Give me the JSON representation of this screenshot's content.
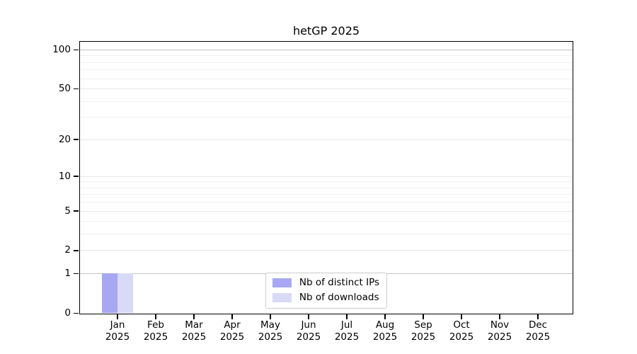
{
  "chart_data": {
    "type": "bar",
    "title": "hetGP 2025",
    "categories": [
      "Jan",
      "Feb",
      "Mar",
      "Apr",
      "May",
      "Jun",
      "Jul",
      "Aug",
      "Sep",
      "Oct",
      "Nov",
      "Dec"
    ],
    "category_year": "2025",
    "series": [
      {
        "name": "Nb of distinct IPs",
        "color": "#a7a7f3",
        "values": [
          1,
          0,
          0,
          0,
          0,
          0,
          0,
          0,
          0,
          0,
          0,
          0
        ]
      },
      {
        "name": "Nb of downloads",
        "color": "#d9d9f8",
        "values": [
          1,
          0,
          0,
          0,
          0,
          0,
          0,
          0,
          0,
          0,
          0,
          0
        ]
      }
    ],
    "xlabel": "",
    "ylabel": "",
    "y_scale": "log1p",
    "ylim": [
      0,
      117
    ],
    "y_major_ticks": [
      0,
      1,
      2,
      5,
      10,
      20,
      50,
      100
    ],
    "y_minor_gridlines": [
      3,
      4,
      6,
      7,
      8,
      9,
      30,
      40,
      60,
      70,
      80,
      90
    ],
    "y_emphasized_gridlines": [
      1,
      100
    ],
    "grid": true,
    "legend_position": "lower center inside plot",
    "colors": {
      "background": "#ffffff",
      "axis": "#000000",
      "grid_minor": "#f0f0f0",
      "grid_major": "#e8e8e8",
      "grid_emphasis": "#c4c4c4",
      "legend_border": "#cccccc"
    }
  }
}
